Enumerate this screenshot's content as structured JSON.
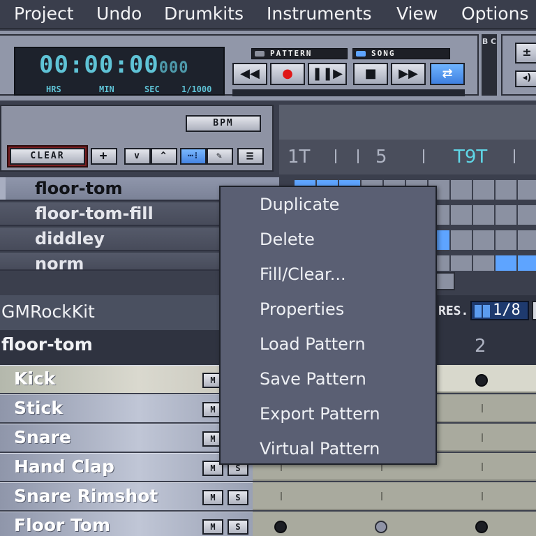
{
  "menubar": {
    "items": [
      "Project",
      "Undo",
      "Drumkits",
      "Instruments",
      "View",
      "Options"
    ]
  },
  "transport": {
    "time_display": "00:00:00",
    "time_ms_display": "000",
    "labels": {
      "hrs": "HRS",
      "min": "MIN",
      "sec": "SEC",
      "ms": "1/1000"
    },
    "mode_pattern": "PATTERN",
    "mode_song": "SONG",
    "buttons": {
      "rewind": "◀◀",
      "record": "●",
      "play_pause": "❚❚▶",
      "stop": "■",
      "fast_forward": "▶▶",
      "loop": "⇄"
    },
    "bc_label": "B C",
    "right_plus_minus": "±",
    "right_speaker": "◂)"
  },
  "pattern_panel": {
    "bpm_label": "BPM",
    "clear_label": "CLEAR",
    "add_label": "+",
    "down_label": "v",
    "up_label": "^",
    "list_mode_label": "≡",
    "patterns": [
      {
        "name": "floor-tom",
        "selected": true
      },
      {
        "name": "floor-tom-fill",
        "selected": false
      },
      {
        "name": "diddley",
        "selected": false
      },
      {
        "name": "norm",
        "selected": false
      }
    ]
  },
  "song_ruler": {
    "marks": [
      "1T",
      "5",
      "T9T"
    ]
  },
  "drumkit": {
    "name": "GMRockKit",
    "res_label": "RES.",
    "res_value": "1/8"
  },
  "pattern_editor": {
    "pattern_name": "floor-tom",
    "bar_number": "2",
    "instruments": [
      {
        "name": "Kick",
        "selected": true
      },
      {
        "name": "Stick",
        "selected": false
      },
      {
        "name": "Snare",
        "selected": false
      },
      {
        "name": "Hand Clap",
        "selected": false
      },
      {
        "name": "Snare Rimshot",
        "selected": false
      },
      {
        "name": "Floor Tom",
        "selected": false
      }
    ],
    "mute_label": "M",
    "solo_label": "S"
  },
  "context_menu": {
    "items": [
      "Duplicate",
      "Delete",
      "Fill/Clear...",
      "Properties",
      "Load Pattern",
      "Save Pattern",
      "Export Pattern",
      "Virtual Pattern"
    ]
  },
  "colors": {
    "accent_blue": "#5ea4ff",
    "lcd_text": "#5fc3d6",
    "record_red": "#e01818",
    "background": "#3b3f4d"
  }
}
